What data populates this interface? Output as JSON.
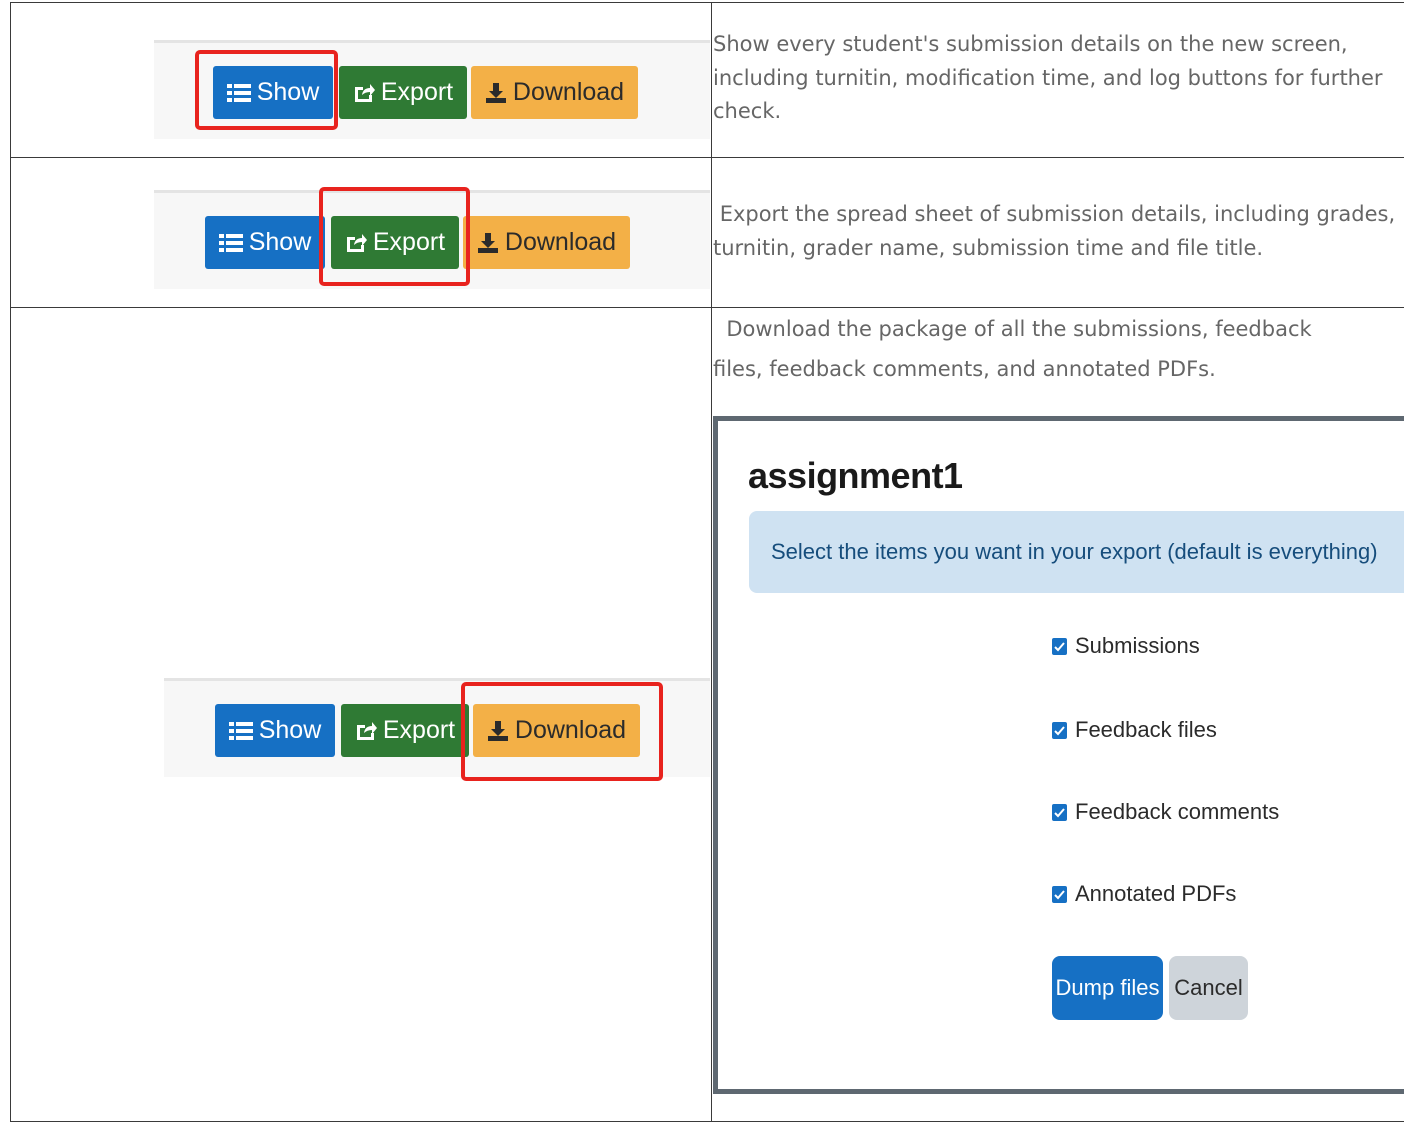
{
  "rows": [
    {
      "buttons": {
        "show": "Show",
        "export": "Export",
        "download": "Download"
      },
      "highlighted": "show",
      "description": "Show every student's submission details on the new screen, including turnitin, modification time, and log buttons for further check."
    },
    {
      "buttons": {
        "show": "Show",
        "export": "Export",
        "download": "Download"
      },
      "highlighted": "export",
      "description": " Export the spread sheet of submission details, including grades, turnitin, grader name, submission time and file title."
    },
    {
      "buttons": {
        "show": "Show",
        "export": "Export",
        "download": "Download"
      },
      "highlighted": "download",
      "description_line1": "  Download the package of all the submissions, feedback",
      "description_line2": "files, feedback comments, and annotated PDFs."
    }
  ],
  "dialog": {
    "title": "assignment1",
    "info": "Select the items you want in your export (default is everything)",
    "options": [
      {
        "label": "Submissions",
        "checked": true
      },
      {
        "label": "Feedback files",
        "checked": true
      },
      {
        "label": "Feedback comments",
        "checked": true
      },
      {
        "label": "Annotated PDFs",
        "checked": true
      }
    ],
    "primary_button": "Dump files",
    "secondary_button": "Cancel"
  },
  "colors": {
    "show": "#1670c4",
    "export": "#2f7a34",
    "download": "#f3b047",
    "highlight": "#e8231e",
    "info_bg": "#cfe2f2"
  },
  "icons": {
    "show": "list-icon",
    "export": "share-icon",
    "download": "download-icon",
    "checkbox": "checkmark-icon"
  }
}
